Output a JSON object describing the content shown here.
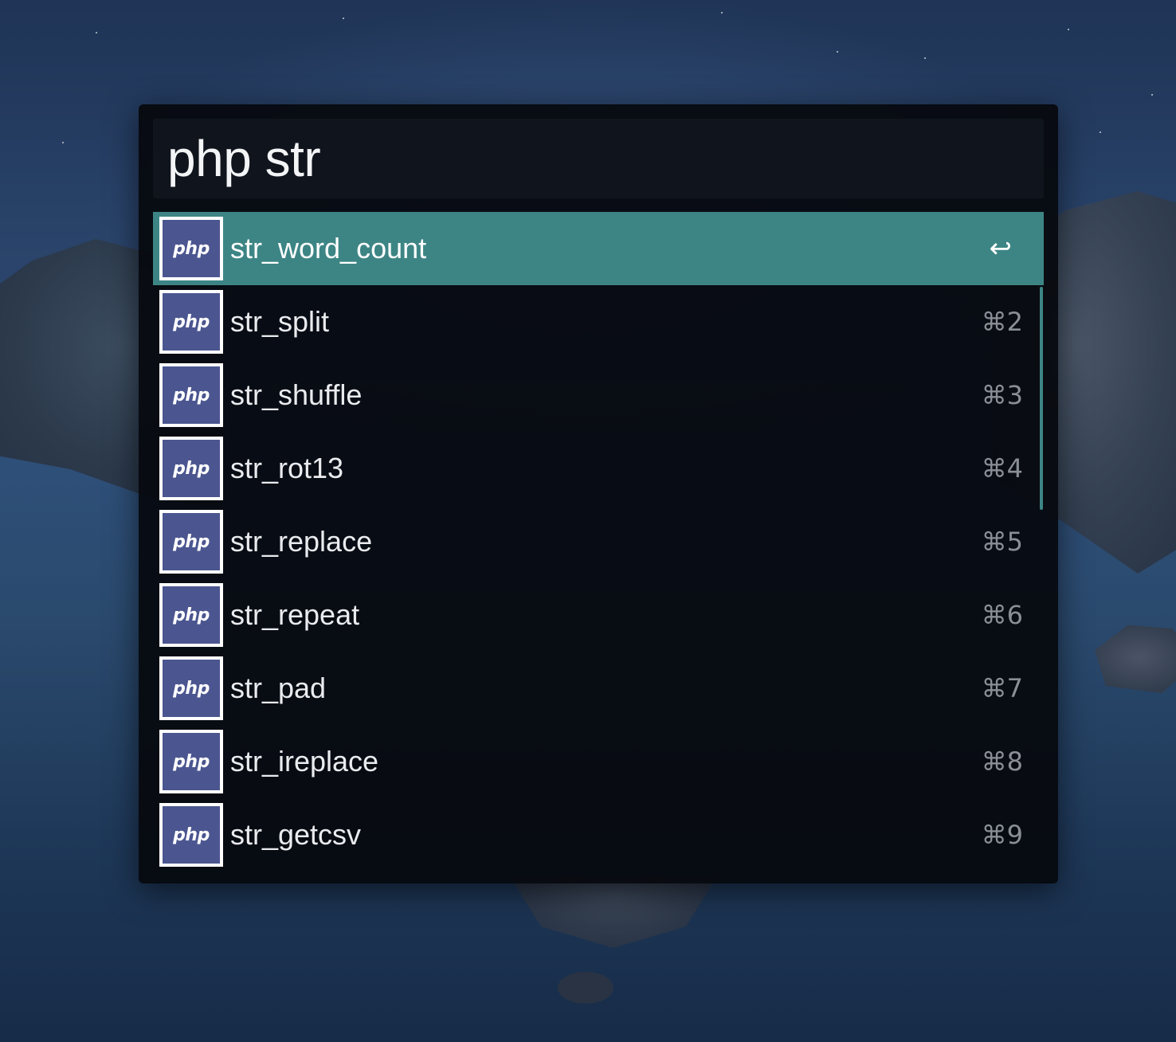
{
  "query": {
    "text": "php str"
  },
  "results": [
    {
      "title": "str_word_count",
      "icon": "php-icon",
      "icon_label": "php",
      "shortcut": "↩",
      "selected": true
    },
    {
      "title": "str_split",
      "icon": "php-icon",
      "icon_label": "php",
      "shortcut": "⌘2"
    },
    {
      "title": "str_shuffle",
      "icon": "php-icon",
      "icon_label": "php",
      "shortcut": "⌘3"
    },
    {
      "title": "str_rot13",
      "icon": "php-icon",
      "icon_label": "php",
      "shortcut": "⌘4"
    },
    {
      "title": "str_replace",
      "icon": "php-icon",
      "icon_label": "php",
      "shortcut": "⌘5"
    },
    {
      "title": "str_repeat",
      "icon": "php-icon",
      "icon_label": "php",
      "shortcut": "⌘6"
    },
    {
      "title": "str_pad",
      "icon": "php-icon",
      "icon_label": "php",
      "shortcut": "⌘7"
    },
    {
      "title": "str_ireplace",
      "icon": "php-icon",
      "icon_label": "php",
      "shortcut": "⌘8"
    },
    {
      "title": "str_getcsv",
      "icon": "php-icon",
      "icon_label": "php",
      "shortcut": "⌘9"
    }
  ],
  "colors": {
    "selected_row": "#3d8585",
    "php_icon_bg": "#4b5690",
    "panel_bg": "#06090e"
  }
}
